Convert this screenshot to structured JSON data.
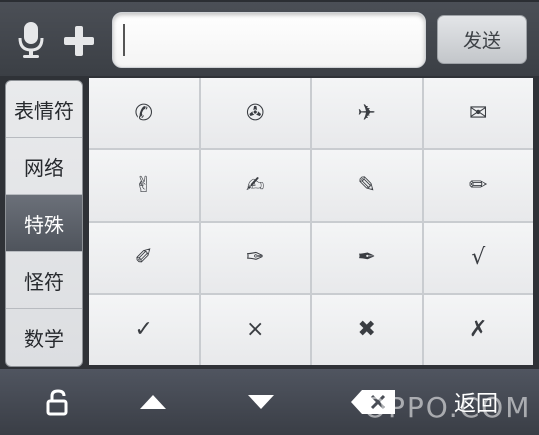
{
  "input_bar": {
    "value": "",
    "send_label": "发送",
    "icons": [
      "microphone-icon",
      "plus-icon"
    ]
  },
  "categories": [
    {
      "label": "表情符",
      "active": false
    },
    {
      "label": "网络",
      "active": false
    },
    {
      "label": "特殊",
      "active": true
    },
    {
      "label": "怪符",
      "active": false
    },
    {
      "label": "数学",
      "active": false
    }
  ],
  "symbols": [
    "✆",
    "✇",
    "✈",
    "✉",
    "✌",
    "✍",
    "✎",
    "✏",
    "✐",
    "✑",
    "✒",
    "√",
    "✓",
    "×",
    "✖",
    "✗"
  ],
  "bottom_bar": {
    "icons": [
      "unlock-icon",
      "arrow-up-icon",
      "arrow-down-icon",
      "backspace-icon"
    ],
    "back_label": "返回",
    "watermark": "OPPO.COM"
  },
  "colors": {
    "active_category": "#5b6068",
    "panel_bg": "#2f3237",
    "cell_bg": "#f0f1f2"
  }
}
